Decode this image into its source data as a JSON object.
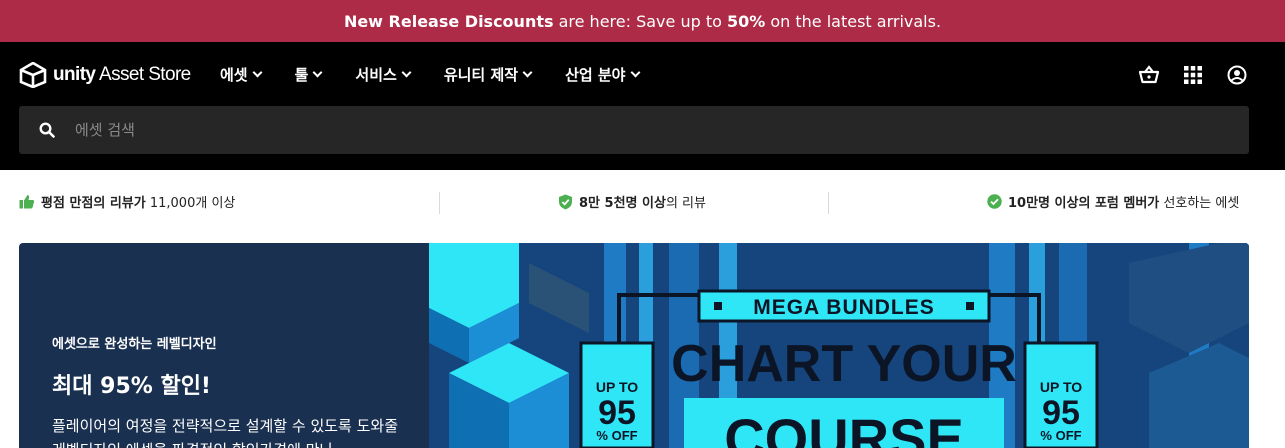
{
  "promo": {
    "part1": "New Release Discounts",
    "part2": " are here: Save up to ",
    "part3": "50%",
    "part4": " on the latest arrivals."
  },
  "nav": {
    "logo_unity": "unity",
    "logo_asset_store": "Asset Store",
    "menu": [
      {
        "label": "에셋"
      },
      {
        "label": "툴"
      },
      {
        "label": "서비스"
      },
      {
        "label": "유니티 제작"
      },
      {
        "label": "산업 분야"
      }
    ],
    "icons": [
      "cart-icon",
      "apps-grid-icon",
      "account-icon"
    ]
  },
  "search": {
    "placeholder": "에셋 검색",
    "value": ""
  },
  "trust": {
    "item1_bold": "평점 만점의 리뷰가",
    "item1_rest": " 11,000개 이상",
    "item2_bold": "8만 5천명 이상",
    "item2_rest": "의 리뷰",
    "item3_bold": "10만명 이상의 포럼 멤버가",
    "item3_rest": " 선호하는 에셋"
  },
  "banner": {
    "kicker": "에셋으로 완성하는 레벨디자인",
    "title": "최대 95% 할인!",
    "description": "플레이어의 여정을 전략적으로 설계할 수 있도록 도와줄 레벨디자인 에셋을 파격적인 할인가격에 만나",
    "art": {
      "ribbon": "MEGA BUNDLES",
      "headline1": "CHART YOUR",
      "headline2": "COURSE",
      "badge_upto": "UP TO",
      "badge_num": "95",
      "badge_off": "% OFF"
    },
    "colors": {
      "bg": "#1a3051",
      "cyan": "#2ee6f5",
      "blue": "#1a8bd8",
      "dark": "#0b1526"
    }
  }
}
